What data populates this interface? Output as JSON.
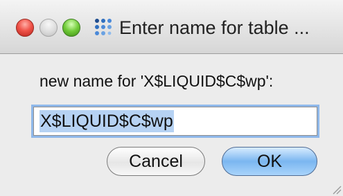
{
  "window": {
    "title": "Enter name for table ...",
    "controls": {
      "close": "close-button",
      "minimize": "minimize-button",
      "zoom": "zoom-button"
    },
    "app_icon": "app-grid-icon"
  },
  "dialog": {
    "prompt": "new name for 'X$LIQUID$C$wp':",
    "name_value": "X$LIQUID$C$wp",
    "cancel_label": "Cancel",
    "ok_label": "OK"
  },
  "colors": {
    "window_bg": "#ececec",
    "focus_ring": "#8fb8ea",
    "selection": "#b6d2f3",
    "default_button": "#7bb6f0"
  }
}
